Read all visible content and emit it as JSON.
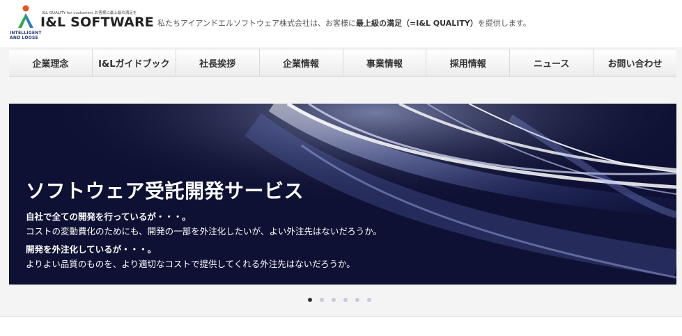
{
  "header": {
    "logo_small_text": "I&L QUALITY  for customers  お客様に最上級の満足を",
    "logo_text": "I&L SOFTWARE",
    "logo_sub_line1": "INTELLIGENT",
    "logo_sub_line2": "AND LOOSE",
    "tagline_prefix": "私たちアイアンドエルソフトウェア株式会社は、お客様に",
    "tagline_bold": "最上級の満足（=I&L QUALITY）",
    "tagline_suffix": "を提供します。"
  },
  "nav": {
    "items": [
      {
        "label": "企業理念"
      },
      {
        "label": "I&Lガイドブック"
      },
      {
        "label": "社長挨拶"
      },
      {
        "label": "企業情報"
      },
      {
        "label": "事業情報"
      },
      {
        "label": "採用情報"
      },
      {
        "label": "ニュース"
      },
      {
        "label": "お問い合わせ"
      }
    ]
  },
  "hero": {
    "title": "ソフトウェア受託開発サービス",
    "line1": "自社で全ての開発を行っているが・・・。",
    "line2": "コストの変動費化のためにも、開発の一部を外注化したいが、よい外注先はないだろうか。",
    "line3": "開発を外注化しているが・・・。",
    "line4": "よりよい品質のものを、より適切なコストで提供してくれる外注先はないだろうか。"
  },
  "carousel": {
    "slide_count": 6,
    "active_index": 0
  },
  "colors": {
    "hero_bg": "#0e1133",
    "logo_orange": "#e8541e",
    "logo_green": "#2fa84f",
    "logo_blue": "#2a3a7a"
  }
}
